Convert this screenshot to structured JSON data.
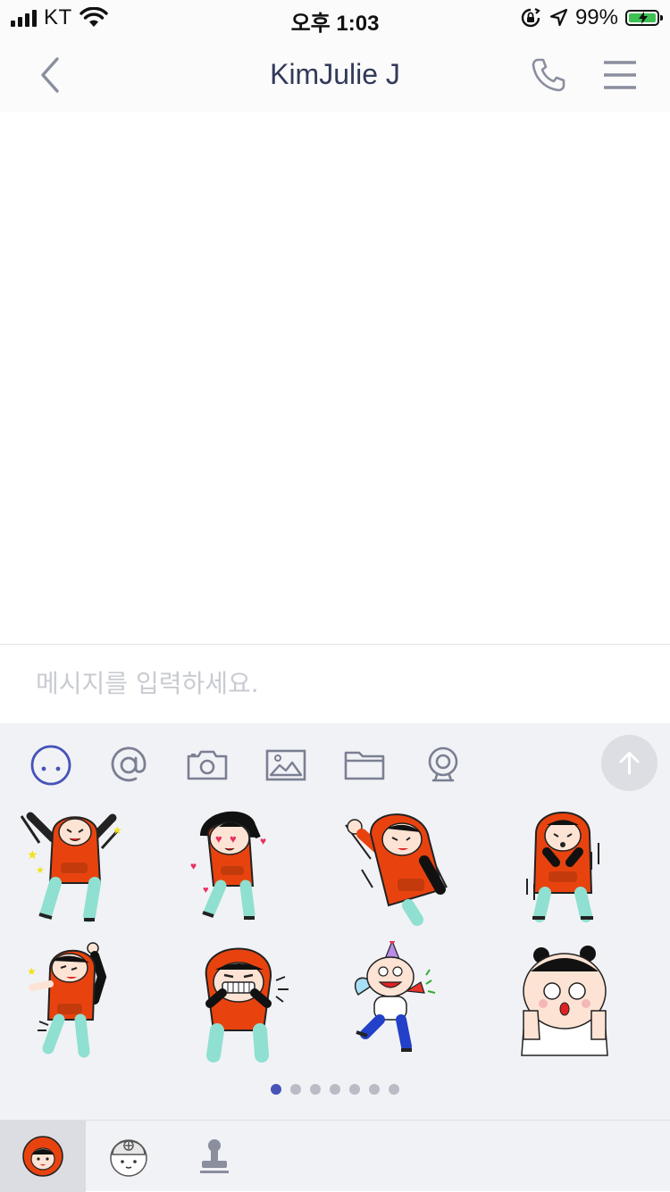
{
  "status_bar": {
    "carrier": "KT",
    "time": "오후 1:03",
    "battery_percent": "99%",
    "battery_level": 0.99,
    "icons": [
      "signal-icon",
      "wifi-icon",
      "orientation-lock-icon",
      "location-arrow-icon",
      "battery-icon"
    ]
  },
  "header": {
    "title": "KimJulie J",
    "back_icon": "chevron-left-icon",
    "call_icon": "phone-icon",
    "menu_icon": "hamburger-menu-icon"
  },
  "composer": {
    "placeholder": "메시지를 입력하세요."
  },
  "toolbar": {
    "items": [
      "emoji-icon",
      "mention-icon",
      "camera-icon",
      "gallery-icon",
      "folder-icon",
      "webcam-icon"
    ],
    "active_item": "emoji-icon",
    "send_icon": "arrow-up-icon"
  },
  "stickers": {
    "items": [
      "hoodie-girl-cheering",
      "hoodie-girl-heart-eyes",
      "hoodie-girl-waving",
      "hoodie-girl-shocked",
      "hoodie-girl-pointing",
      "hoodie-girl-grinning",
      "cupid-boy-party-horn",
      "bun-hair-thumbs-up"
    ],
    "page_count": 7,
    "current_page": 1
  },
  "sticker_tabs": {
    "items": [
      "hoodie-girl-pack",
      "helmet-character-pack",
      "stamp-pack"
    ],
    "selected_index": 0
  },
  "colors": {
    "accent": "#4654b8",
    "title": "#323a5a",
    "hoodie_orange": "#e8430f",
    "pants_mint": "#8fe0d0",
    "battery_green": "#3cc152"
  }
}
